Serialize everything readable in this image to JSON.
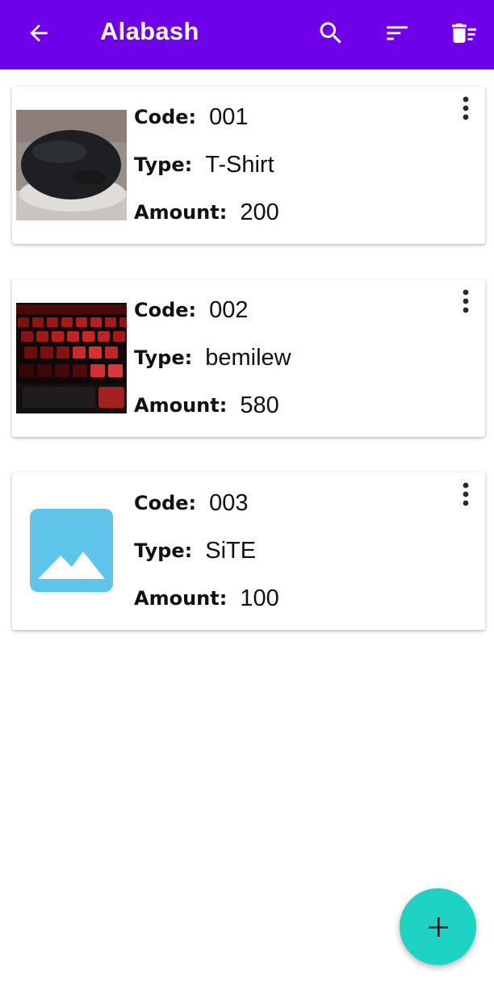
{
  "app_bar": {
    "title": "Alabash",
    "background": "#6f00ea",
    "icons": [
      "arrow-back-icon",
      "search-icon",
      "sort-icon",
      "delete-sweep-icon"
    ]
  },
  "labels": {
    "code": "Code:",
    "type": "Type:",
    "amount": "Amount:"
  },
  "items": [
    {
      "code": "001",
      "type": "T-Shirt",
      "amount": "200",
      "image": "photo-dark-earbuds-case"
    },
    {
      "code": "002",
      "type": "bemilew",
      "amount": "580",
      "image": "photo-red-backlit-keyboard"
    },
    {
      "code": "003",
      "type": "SiTE",
      "amount": "100",
      "image": "image-placeholder-icon"
    }
  ],
  "fab": {
    "icon": "plus-icon",
    "color": "#1ed3c2"
  }
}
